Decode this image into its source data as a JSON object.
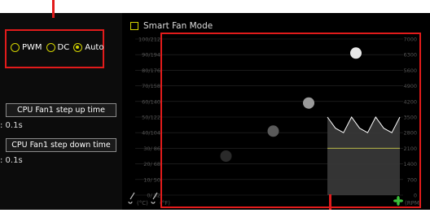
{
  "fan_mode": {
    "options": [
      {
        "label": "PWM",
        "selected": false
      },
      {
        "label": "DC",
        "selected": false
      },
      {
        "label": "Auto",
        "selected": true
      }
    ]
  },
  "step_up": {
    "label": "CPU Fan1 step up time",
    "value": ": 0.1s"
  },
  "step_down": {
    "label": "CPU Fan1 step down time",
    "value": ": 0.1s"
  },
  "smart_fan": {
    "label": "Smart Fan Mode",
    "checked": false
  },
  "chart_data": {
    "type": "line",
    "left_axis_ticks": [
      "100/212",
      "90/194",
      "80/176",
      "70/158",
      "60/140",
      "50/122",
      "40/104",
      "30/ 86",
      "20/ 68",
      "10/ 50",
      "0/ 32"
    ],
    "right_axis_ticks": [
      "7000",
      "6300",
      "5600",
      "4900",
      "4200",
      "3500",
      "2800",
      "2100",
      "1400",
      "700",
      "0"
    ],
    "left_unit": "(°C)",
    "left_unit_2": "(°F)",
    "right_unit": "(RPM)",
    "ylim_temperature_c": [
      0,
      100
    ],
    "ylim_rpm": [
      0,
      7000
    ],
    "grid": true,
    "control_points": [
      {
        "temp_c": 25,
        "percent": 25
      },
      {
        "temp_c": 45,
        "percent": 41
      },
      {
        "temp_c": 60,
        "percent": 59
      },
      {
        "temp_c": 80,
        "percent": 91
      }
    ],
    "control_point_colors": [
      "#2a2a2a",
      "#5a5a5a",
      "#9a9a9a",
      "#e8e8e8"
    ],
    "rpm_trace": [
      3500,
      3000,
      2800,
      3500,
      3000,
      2800,
      3500,
      3000,
      2800,
      3500
    ],
    "temp_trace_c": 30,
    "colors": {
      "accent": "#e21b1b",
      "radio": "#d4d400",
      "temp_line": "#b8b84a",
      "rpm_line": "#ffffff",
      "grid": "#2a2a2a"
    }
  }
}
